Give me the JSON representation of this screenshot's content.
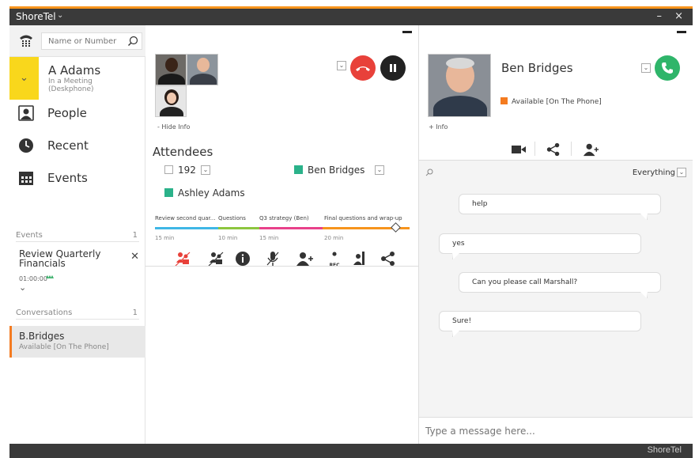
{
  "window": {
    "app_name": "ShoreTel",
    "controls": "– ×"
  },
  "search": {
    "placeholder": "Name or Number"
  },
  "user": {
    "name": "A Adams",
    "status_line1": "In a Meeting",
    "status_line2": "(Deskphone)"
  },
  "nav": [
    {
      "label": "People",
      "icon": "person-icon"
    },
    {
      "label": "Recent",
      "icon": "clock-icon"
    },
    {
      "label": "Events",
      "icon": "calendar-icon"
    }
  ],
  "events_section": {
    "title": "Events",
    "count": "1",
    "event": {
      "title": "Review Quarterly Financials",
      "time": "01:00:00",
      "attendees_glyph": "▴▴▴"
    }
  },
  "conversations_section": {
    "title": "Conversations",
    "count": "1",
    "item": {
      "name": "B.Bridges",
      "status": "Available [On The Phone]"
    }
  },
  "call": {
    "hide_info": "- Hide Info",
    "attendees_title": "Attendees",
    "attendees": [
      {
        "label": "192",
        "color": ""
      },
      {
        "label": "Ben Bridges",
        "color": "#2bb28a"
      },
      {
        "label": "Ashley Adams",
        "color": "#2bb28a"
      }
    ],
    "agenda": [
      {
        "label": "Review second quar...",
        "time": "15 min",
        "color": "#3fb7e6"
      },
      {
        "label": "Questions",
        "time": "10 min",
        "color": "#8dc63f"
      },
      {
        "label": "Q3 strategy (Ben)",
        "time": "15 min",
        "color": "#e8418a"
      },
      {
        "label": "Final questions and wrap-up",
        "time": "20 min",
        "color": "#f7941d"
      }
    ],
    "rec_label": "REC",
    "colors": {
      "hangup": "#e8413a",
      "hold": "#222222"
    }
  },
  "contact": {
    "name": "Ben Bridges",
    "status": "Available [On The Phone]",
    "status_color": "#f47b20",
    "plus_info": "+ Info",
    "call_color": "#2fb56a"
  },
  "chat": {
    "filter": "Everything",
    "messages": [
      {
        "text": "help",
        "side": "right"
      },
      {
        "text": "yes",
        "side": "left"
      },
      {
        "text": "Can you please call Marshall?",
        "side": "right"
      },
      {
        "text": "Sure!",
        "side": "left"
      }
    ],
    "compose_placeholder": "Type a message here..."
  },
  "footer": {
    "logo": "ShoreTel"
  }
}
